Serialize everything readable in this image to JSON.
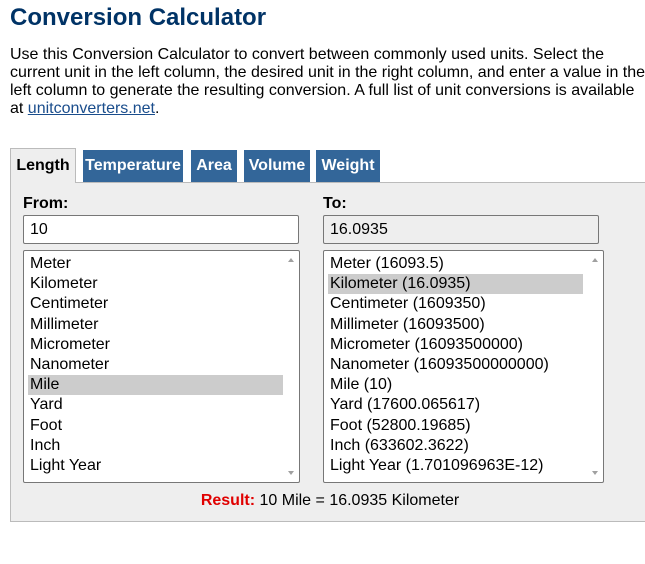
{
  "page": {
    "title": "Conversion Calculator",
    "intro_text": "Use this Conversion Calculator to convert between commonly used units. Select the current unit in the left column, the desired unit in the right column, and enter a value in the left column to generate the resulting conversion. A full list of unit conversions is available at ",
    "intro_link": "unitconverters.net",
    "intro_end": "."
  },
  "tabs": [
    "Length",
    "Temperature",
    "Area",
    "Volume",
    "Weight"
  ],
  "active_tab": "Length",
  "from": {
    "label": "From:",
    "value": "10",
    "units": [
      "Meter",
      "Kilometer",
      "Centimeter",
      "Millimeter",
      "Micrometer",
      "Nanometer",
      "Mile",
      "Yard",
      "Foot",
      "Inch",
      "Light Year"
    ],
    "selected": "Mile"
  },
  "to": {
    "label": "To:",
    "value": "16.0935",
    "units": [
      "Meter (16093.5)",
      "Kilometer (16.0935)",
      "Centimeter (1609350)",
      "Millimeter (16093500)",
      "Micrometer (16093500000)",
      "Nanometer (16093500000000)",
      "Mile (10)",
      "Yard (17600.065617)",
      "Foot (52800.19685)",
      "Inch (633602.3622)",
      "Light Year (1.701096963E-12)"
    ],
    "selected": "Kilometer (16.0935)"
  },
  "result": {
    "label": "Result:",
    "text": "10 Mile = 16.0935 Kilometer"
  },
  "colors": {
    "title": "#003366",
    "tab": "#336699",
    "result_label": "#e00000"
  }
}
